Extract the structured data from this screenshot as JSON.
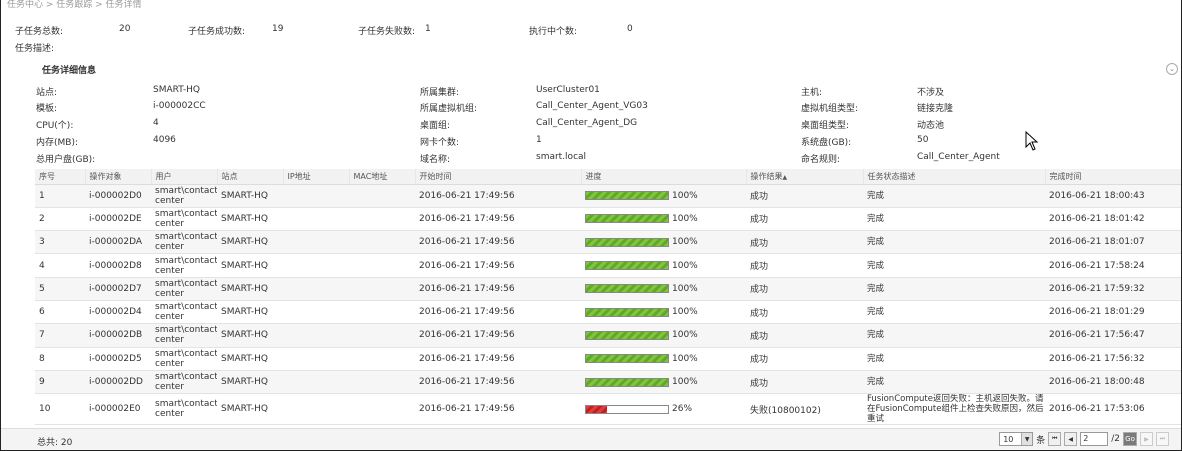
{
  "breadcrumb": "任务中心 > 任务跟踪 > 任务详情",
  "summary": {
    "total_label": "子任务总数:",
    "total_value": "20",
    "success_label": "子任务成功数:",
    "success_value": "19",
    "fail_label": "子任务失败数:",
    "fail_value": "1",
    "running_label": "执行中个数:",
    "running_value": "0"
  },
  "description_label": "任务描述:",
  "details": {
    "title": "任务详细信息",
    "site_label": "站点:",
    "site_value": "SMART-HQ",
    "cluster_label": "所属集群:",
    "cluster_value": "UserCluster01",
    "host_label": "主机:",
    "host_value": "不涉及",
    "template_label": "模板:",
    "template_value": "i-000002CC",
    "vmgroup_label": "所属虚拟机组:",
    "vmgroup_value": "Call_Center_Agent_VG03",
    "vmgroup_type_label": "虚拟机组类型:",
    "vmgroup_type_value": "链接克隆",
    "cpu_label": "CPU(个):",
    "cpu_value": "4",
    "desktop_group_label": "桌面组:",
    "desktop_group_value": "Call_Center_Agent_DG",
    "desktop_group_type_label": "桌面组类型:",
    "desktop_group_type_value": "动态池",
    "memory_label": "内存(MB):",
    "memory_value": "4096",
    "nic_label": "网卡个数:",
    "nic_value": "1",
    "sysdisk_label": "系统盘(GB):",
    "sysdisk_value": "50",
    "userdisk_label": "总用户盘(GB):",
    "domain_label": "域名称:",
    "domain_value": "smart.local",
    "naming_label": "命名规则:",
    "naming_value": "Call_Center_Agent"
  },
  "table": {
    "headers": [
      "序号",
      "操作对象",
      "用户",
      "站点",
      "IP地址",
      "MAC地址",
      "开始时间",
      "进度",
      "操作结果",
      "任务状态描述",
      "完成时间"
    ],
    "rows": [
      {
        "no": "1",
        "obj": "i-000002D0",
        "user": "smart\\contact center",
        "site": "SMART-HQ",
        "ip": "",
        "mac": "",
        "start": "2016-06-21 17:49:56",
        "progress": 100,
        "progress_text": "100%",
        "result": "成功",
        "desc": "完成",
        "end": "2016-06-21 18:00:43"
      },
      {
        "no": "2",
        "obj": "i-000002DE",
        "user": "smart\\contact center",
        "site": "SMART-HQ",
        "ip": "",
        "mac": "",
        "start": "2016-06-21 17:49:56",
        "progress": 100,
        "progress_text": "100%",
        "result": "成功",
        "desc": "完成",
        "end": "2016-06-21 18:01:42"
      },
      {
        "no": "3",
        "obj": "i-000002DA",
        "user": "smart\\contact center",
        "site": "SMART-HQ",
        "ip": "",
        "mac": "",
        "start": "2016-06-21 17:49:56",
        "progress": 100,
        "progress_text": "100%",
        "result": "成功",
        "desc": "完成",
        "end": "2016-06-21 18:01:07"
      },
      {
        "no": "4",
        "obj": "i-000002D8",
        "user": "smart\\contact center",
        "site": "SMART-HQ",
        "ip": "",
        "mac": "",
        "start": "2016-06-21 17:49:56",
        "progress": 100,
        "progress_text": "100%",
        "result": "成功",
        "desc": "完成",
        "end": "2016-06-21 17:58:24"
      },
      {
        "no": "5",
        "obj": "i-000002D7",
        "user": "smart\\contact center",
        "site": "SMART-HQ",
        "ip": "",
        "mac": "",
        "start": "2016-06-21 17:49:56",
        "progress": 100,
        "progress_text": "100%",
        "result": "成功",
        "desc": "完成",
        "end": "2016-06-21 17:59:32"
      },
      {
        "no": "6",
        "obj": "i-000002D4",
        "user": "smart\\contact center",
        "site": "SMART-HQ",
        "ip": "",
        "mac": "",
        "start": "2016-06-21 17:49:56",
        "progress": 100,
        "progress_text": "100%",
        "result": "成功",
        "desc": "完成",
        "end": "2016-06-21 18:01:29"
      },
      {
        "no": "7",
        "obj": "i-000002DB",
        "user": "smart\\contact center",
        "site": "SMART-HQ",
        "ip": "",
        "mac": "",
        "start": "2016-06-21 17:49:56",
        "progress": 100,
        "progress_text": "100%",
        "result": "成功",
        "desc": "完成",
        "end": "2016-06-21 17:56:47"
      },
      {
        "no": "8",
        "obj": "i-000002D5",
        "user": "smart\\contact center",
        "site": "SMART-HQ",
        "ip": "",
        "mac": "",
        "start": "2016-06-21 17:49:56",
        "progress": 100,
        "progress_text": "100%",
        "result": "成功",
        "desc": "完成",
        "end": "2016-06-21 17:56:32"
      },
      {
        "no": "9",
        "obj": "i-000002DD",
        "user": "smart\\contact center",
        "site": "SMART-HQ",
        "ip": "",
        "mac": "",
        "start": "2016-06-21 17:49:56",
        "progress": 100,
        "progress_text": "100%",
        "result": "成功",
        "desc": "完成",
        "end": "2016-06-21 18:00:48"
      },
      {
        "no": "10",
        "obj": "i-000002E0",
        "user": "smart\\contact center",
        "site": "SMART-HQ",
        "ip": "",
        "mac": "",
        "start": "2016-06-21 17:49:56",
        "progress": 26,
        "progress_text": "26%",
        "result": "失败(10800102)",
        "desc": "FusionCompute返回失败：主机返回失败。请在FusionCompute组件上检查失败原因，然后重试",
        "end": "2016-06-21 17:53:06"
      }
    ]
  },
  "footer": {
    "total_label": "总共: 20",
    "page_size": "10",
    "per_label": "条",
    "current_page": "2",
    "total_pages": "/2",
    "go_label": "Go"
  },
  "colors": {
    "progress_ok": "#6fb832",
    "progress_fail": "#d22b2b"
  }
}
